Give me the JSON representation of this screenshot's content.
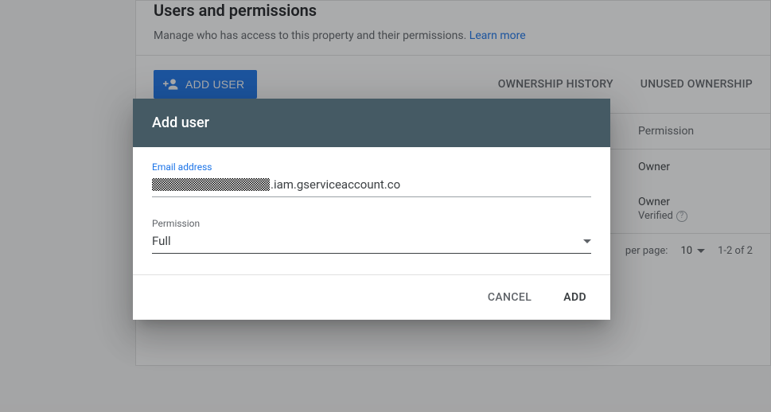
{
  "page": {
    "title": "Users and permissions",
    "subtitle": "Manage who has access to this property and their permissions. ",
    "learnMore": "Learn more"
  },
  "toolbar": {
    "addUser": "ADD USER",
    "tabs": {
      "ownershipHistory": "OWNERSHIP HISTORY",
      "unusedOwnership": "UNUSED OWNERSHIP"
    }
  },
  "table": {
    "headers": {
      "permission": "Permission"
    },
    "rows": [
      {
        "permission": "Owner",
        "verified": false
      },
      {
        "permission": "Owner",
        "verified": true,
        "verifiedLabel": "Verified"
      }
    ]
  },
  "pager": {
    "rowsPerPageLabel": "per page:",
    "rowsPerPage": "10",
    "range": "1-2 of 2"
  },
  "dialog": {
    "title": "Add user",
    "emailLabel": "Email address",
    "emailSuffix": ".iam.gserviceaccount.co",
    "permissionLabel": "Permission",
    "permissionValue": "Full",
    "cancel": "CANCEL",
    "add": "ADD"
  }
}
